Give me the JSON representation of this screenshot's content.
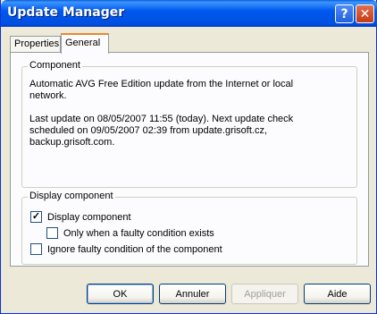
{
  "window": {
    "title": "Update Manager",
    "help_glyph": "?",
    "close_glyph": "✕"
  },
  "tabs": [
    {
      "label": "Properties",
      "selected": false
    },
    {
      "label": "General",
      "selected": true
    }
  ],
  "component_group": {
    "label": "Component",
    "description": "Automatic AVG Free Edition update from the Internet or local network.",
    "status": "Last update on 08/05/2007 11:55 (today). Next update check scheduled on 09/05/2007 02:39 from update.grisoft.cz, backup.grisoft.com."
  },
  "display_group": {
    "label": "Display component",
    "checkboxes": [
      {
        "label": "Display component",
        "checked": true,
        "mark": "✓"
      },
      {
        "label": "Only when a faulty condition exists",
        "checked": false,
        "mark": ""
      },
      {
        "label": "Ignore faulty condition of the component",
        "checked": false,
        "mark": ""
      }
    ]
  },
  "buttons": {
    "ok": "OK",
    "cancel": "Annuler",
    "apply": "Appliquer",
    "help": "Aide"
  },
  "colors": {
    "titlebar": "#0058ee",
    "window_bg": "#ece9d8",
    "tab_accent": "#e68b2c",
    "disabled_text": "#a0a098"
  }
}
